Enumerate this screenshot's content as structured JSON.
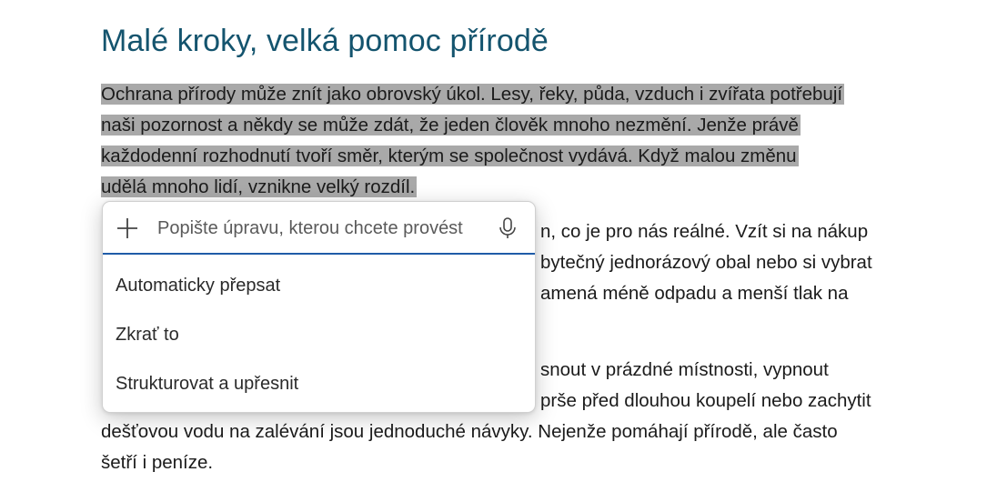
{
  "document": {
    "title": "Malé kroky, velká pomoc přírodě",
    "paragraph1": [
      "Ochrana přírody může znít jako obrovský úkol. Lesy, řeky, půda, vzduch i zvířata potřebují",
      "naši pozornost a někdy se může zdát, že jeden člověk mnoho nezmění. Jenže právě",
      "každodenní rozhodnutí tvoří směr, kterým se společnost vydává. Když malou změnu",
      "udělá mnoho lidí, vznikne velký rozdíl."
    ],
    "paragraph2": [
      "n, co je pro nás reálné. Vzít si na nákup",
      "bytečný jednorázový obal nebo si vybrat",
      "amená méně odpadu a menší tlak na"
    ],
    "paragraph3": [
      "snout v prázdné místnosti, vypnout",
      "prše před dlouhou koupelí nebo zachytit",
      "dešťovou vodu na zalévání jsou jednoduché návyky. Nejenže pomáhají přírodě, ale často",
      "šetří i peníze."
    ]
  },
  "rewrite_popup": {
    "prompt_placeholder": "Popište úpravu, kterou chcete provést",
    "prompt_value": "",
    "add_icon": "plus-icon",
    "mic_icon": "microphone-icon",
    "options": [
      "Automaticky přepsat",
      "Zkrať to",
      "Strukturovat a upřesnit"
    ]
  },
  "colors": {
    "title": "#14546e",
    "selection": "#a9a9a9",
    "input_underline": "#1f5ca8"
  }
}
